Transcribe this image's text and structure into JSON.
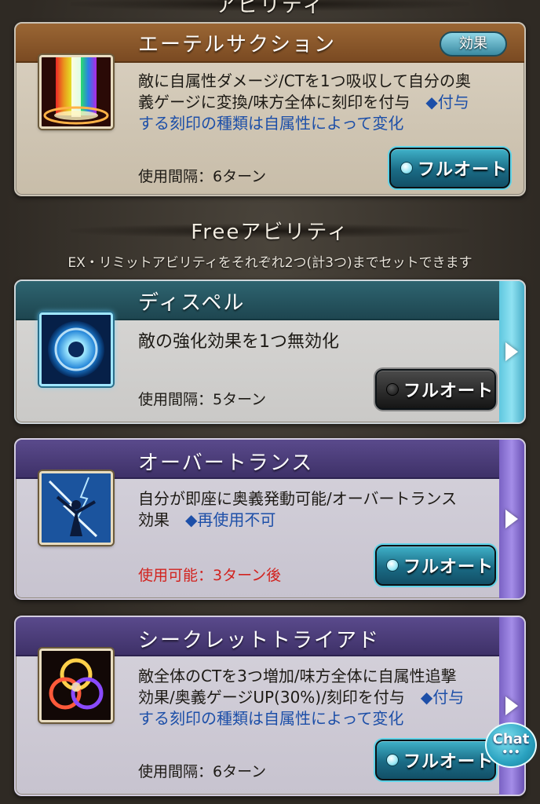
{
  "top_section": {
    "heading": "アビリティ"
  },
  "card1": {
    "title": "エーテルサクション",
    "effect_label": "効果",
    "desc_line1": "敵に自属性ダメージ/CTを1つ吸収して自分の奥",
    "desc_line2a": "義ゲージに変換/味方全体に刻印を付与　",
    "desc_line2b": "◆付与",
    "desc_line3": "する刻印の種類は自属性によって変化",
    "interval": "使用間隔：6ターン",
    "button": "フルオート",
    "button_state": "on",
    "icon": "rainbow-pillar-icon"
  },
  "free_section": {
    "heading": "Freeアビリティ",
    "subtitle": "EX・リミットアビリティをそれぞれ2つ(計3つ)までセットできます"
  },
  "card2": {
    "title": "ディスペル",
    "desc_line1": "敵の強化効果を1つ無効化",
    "interval": "使用間隔：5ターン",
    "button": "フルオート",
    "button_state": "off",
    "icon": "blue-orb-icon"
  },
  "card3": {
    "title": "オーバートランス",
    "desc_line1": "自分が即座に奥義発動可能/オーバートランス",
    "desc_line2a": "効果　",
    "desc_line2b": "◆再使用不可",
    "interval": "使用可能：3ターン後",
    "button": "フルオート",
    "button_state": "on",
    "icon": "lightning-figure-icon"
  },
  "card4": {
    "title": "シークレットトライアド",
    "desc_line1": "敵全体のCTを3つ増加/味方全体に自属性追撃",
    "desc_line2a": "効果/奥義ゲージUP(30%)/刻印を付与　",
    "desc_line2b": "◆付与",
    "desc_line3": "する刻印の種類は自属性によって変化",
    "interval": "使用間隔：6ターン",
    "button": "フルオート",
    "button_state": "on",
    "icon": "triple-ring-icon"
  },
  "chat": {
    "label": "Chat",
    "dots": "•••"
  }
}
